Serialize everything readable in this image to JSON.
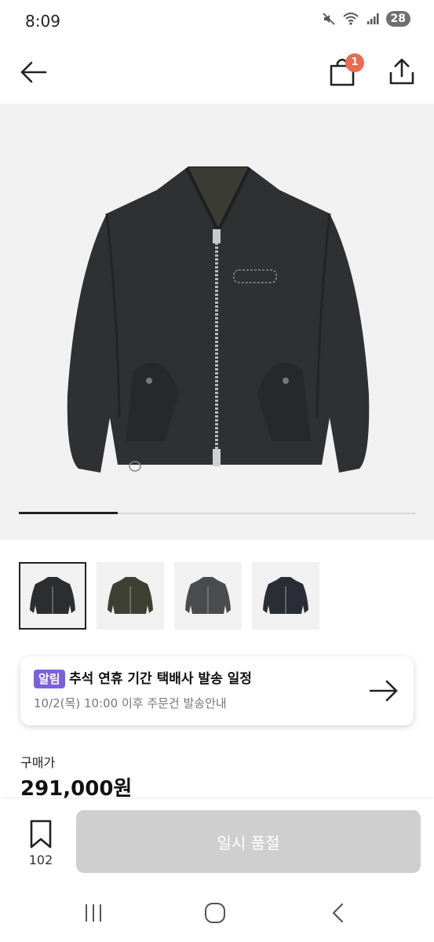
{
  "status_bar": {
    "time": "8:09",
    "battery": "28"
  },
  "header": {
    "cart_badge": "1",
    "back_icon": "arrow-left-icon",
    "cart_icon": "shopping-bag-icon",
    "share_icon": "share-upload-icon"
  },
  "gallery": {
    "image_count": 4,
    "active_index": 0,
    "progress": 0.25,
    "thumbnails": [
      {
        "label": "black-jacket-front",
        "color": "#2c2d2f"
      },
      {
        "label": "olive-jacket-front",
        "color": "#3f4034"
      },
      {
        "label": "charcoal-jacket-front",
        "color": "#4a4b4d"
      },
      {
        "label": "navy-jacket-front",
        "color": "#2b2d36"
      }
    ]
  },
  "notice": {
    "tag": "알림",
    "title": "추석 연휴 기간 택배사 발송 일정",
    "subtitle": "10/2(목) 10:00 이후 주문건 발송안내"
  },
  "price": {
    "label": "구매가",
    "value": "291,000원"
  },
  "actions": {
    "wish_count": "102",
    "primary_label": "일시 품절"
  },
  "colors": {
    "accent_tag": "#7a61de",
    "badge": "#ea6a54",
    "disabled_button": "#cfcfcf"
  }
}
